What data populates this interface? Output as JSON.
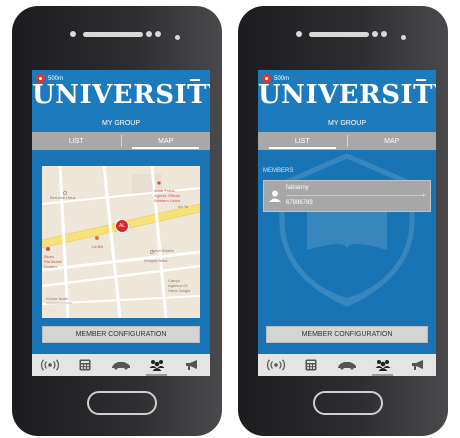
{
  "screens": [
    {
      "distance": "500m",
      "title": "UNIVERSITY",
      "group_title": "MY GROUP",
      "tabs": [
        {
          "label": "LIST",
          "active": false
        },
        {
          "label": "MAP",
          "active": true
        }
      ],
      "map": {
        "labels": {
          "bernardi": "Bernardi Haus",
          "anne_frank": "Anne Frank-\nAgentz Official\nWestern Union",
          "ab_road": "Ab Ta",
          "la_bis": "La Bis",
          "blues": "Blues\nRia Moritz\nHusten",
          "integral": "Integral Bella",
          "grand": "Campt\nAgentur-Gr\nHans Jungla",
          "strasse": "Lindt Straße",
          "kirche": "Kirche Israel"
        },
        "marker_label": "AL"
      },
      "config_button": "MEMBER CONFIGURATION",
      "nav": [
        {
          "icon": "signal-icon",
          "active": false
        },
        {
          "icon": "calculator-icon",
          "active": false
        },
        {
          "icon": "car-icon",
          "active": false
        },
        {
          "icon": "group-icon",
          "active": true
        },
        {
          "icon": "megaphone-icon",
          "active": false
        }
      ]
    },
    {
      "distance": "500m",
      "title": "UNIVERSITY",
      "group_title": "MY GROUP",
      "tabs": [
        {
          "label": "LIST",
          "active": true
        },
        {
          "label": "MAP",
          "active": false
        }
      ],
      "members_heading": "MEMBERS",
      "members": [
        {
          "name": "fabianny",
          "phone": "67896789"
        }
      ],
      "config_button": "MEMBER CONFIGURATION",
      "nav": [
        {
          "icon": "signal-icon",
          "active": false
        },
        {
          "icon": "calculator-icon",
          "active": false
        },
        {
          "icon": "car-icon",
          "active": false
        },
        {
          "icon": "group-icon",
          "active": true
        },
        {
          "icon": "megaphone-icon",
          "active": false
        }
      ]
    }
  ],
  "colors": {
    "primary": "#1d7bbd",
    "tab_bar": "#a8a8a8",
    "marker": "#d8262a"
  }
}
